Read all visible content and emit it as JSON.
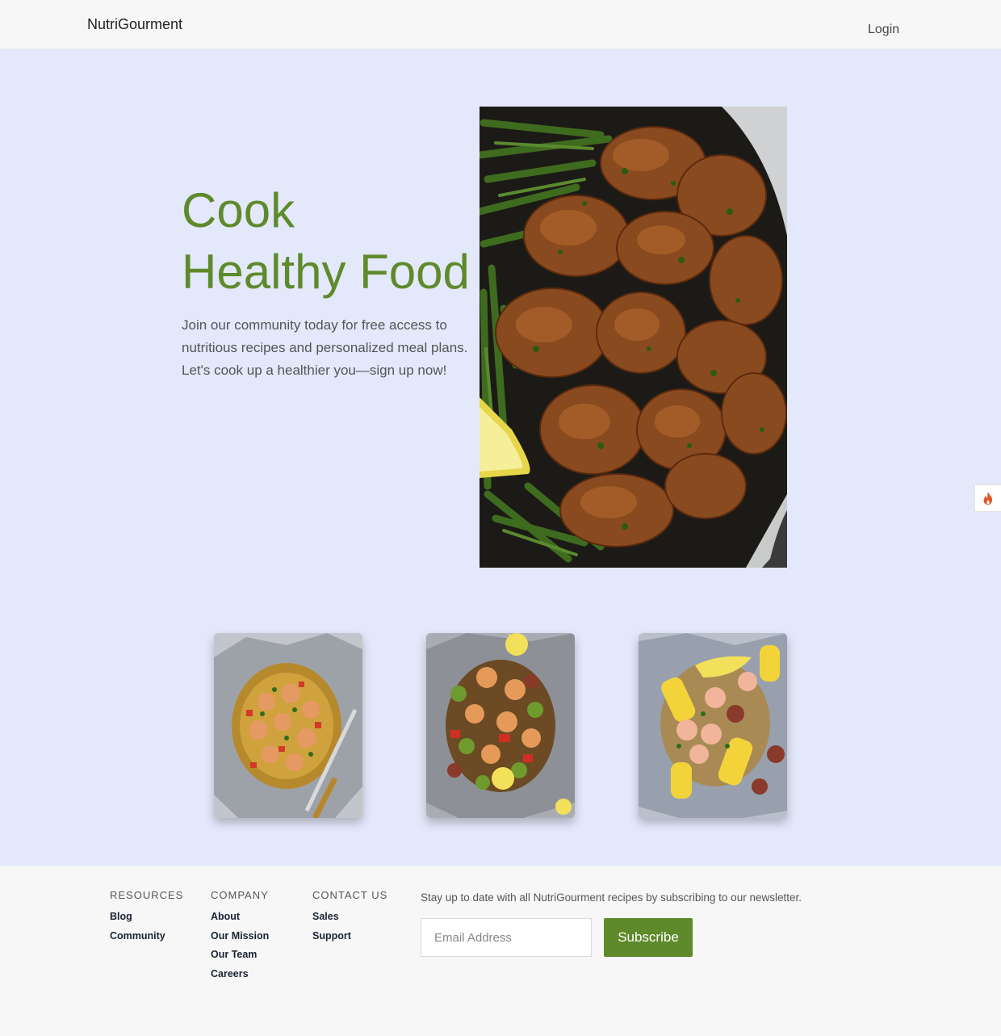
{
  "nav": {
    "brand": "NutriGourment",
    "login_label": "Login"
  },
  "hero": {
    "title_line1": "Cook",
    "title_line2": "Healthy Food",
    "description": "Join our community today for free access to nutritious recipes and personalized meal plans. Let's cook up a healthier you—sign up now!",
    "image": "chicken-skillet-green-beans-photo"
  },
  "cards": [
    {
      "image": "shrimp-foil-packet-fork-photo"
    },
    {
      "image": "shrimp-sausage-zucchini-foil-photo"
    },
    {
      "image": "shrimp-corn-sausage-foil-photo"
    }
  ],
  "side_badge": {
    "icon": "flame-icon"
  },
  "footer": {
    "resources": {
      "title": "RESOURCES",
      "links": [
        "Blog",
        "Community"
      ]
    },
    "company": {
      "title": "COMPANY",
      "links": [
        "About",
        "Our Mission",
        "Our Team",
        "Careers"
      ]
    },
    "contact": {
      "title": "CONTACT US",
      "links": [
        "Sales",
        "Support"
      ]
    },
    "newsletter": {
      "text": "Stay up to date with all NutriGourment recipes by subscribing to our newsletter.",
      "email_placeholder": "Email Address",
      "button_label": "Subscribe"
    }
  },
  "colors": {
    "accent": "#5f8a2b",
    "hero_bg": "#e3e8fb",
    "footer_bg": "#f7f7f7"
  }
}
